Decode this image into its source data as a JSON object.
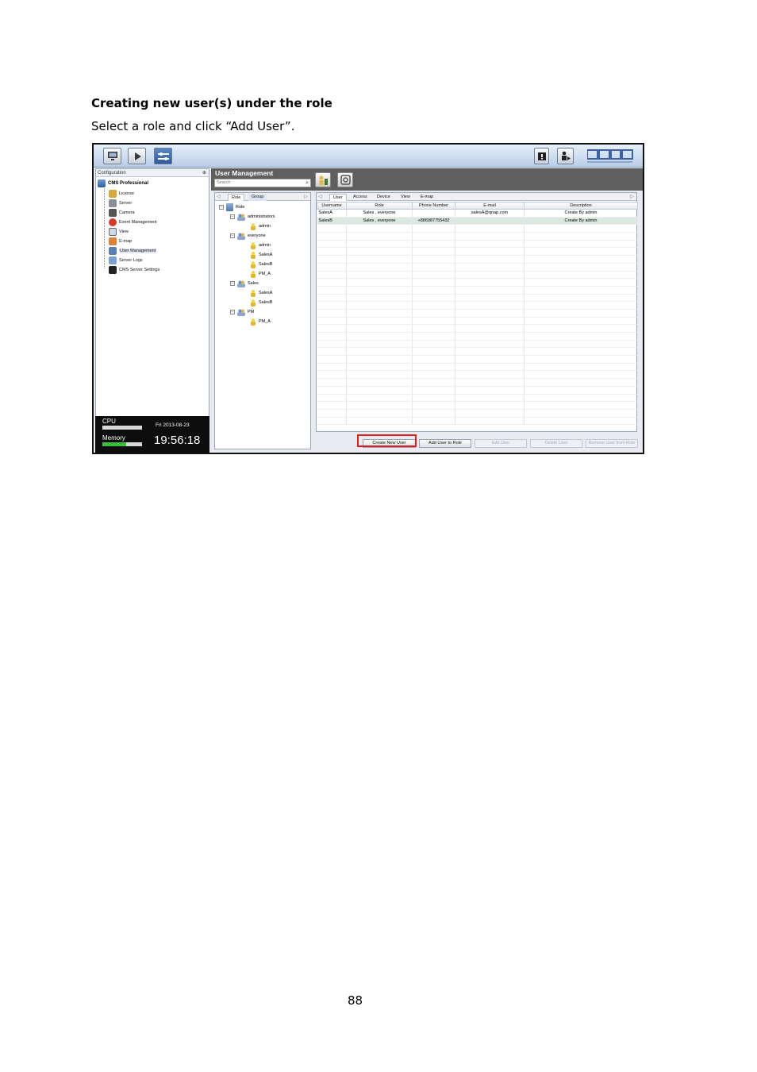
{
  "document": {
    "heading": "Creating new user(s) under the role",
    "instruction": "Select a role and click “Add User”.",
    "page_number": "88"
  },
  "app": {
    "toolbar": {
      "buttons": [
        "monitor-icon",
        "play-icon",
        "settings-icon"
      ],
      "right_icons": [
        "info-icon",
        "user-logout-icon"
      ],
      "logo_text": "QNAP",
      "logo_subtext": "SECURITY"
    },
    "left_panel": {
      "header": "Configuration",
      "pin": "⊕",
      "root": "CMS Professional",
      "items": [
        {
          "label": "License",
          "icon": "license-icon"
        },
        {
          "label": "Server",
          "icon": "server-icon"
        },
        {
          "label": "Camera",
          "icon": "camera-icon"
        },
        {
          "label": "Event Management",
          "icon": "event-icon"
        },
        {
          "label": "View",
          "icon": "view-icon"
        },
        {
          "label": "E-map",
          "icon": "emap-icon"
        },
        {
          "label": "User Management",
          "icon": "user-management-icon"
        },
        {
          "label": "Server Logs",
          "icon": "logs-icon"
        },
        {
          "label": "CMS Server Settings",
          "icon": "server-settings-icon"
        }
      ]
    },
    "status": {
      "cpu_label": "CPU",
      "memory_label": "Memory",
      "date": "Fri 2013-08-23",
      "time": "19:56:18",
      "memory_level": 0.6
    },
    "user_management": {
      "title": "User Management",
      "search_placeholder": "Search",
      "role_tabs": [
        "Role",
        "Group"
      ],
      "tree": {
        "root": "Role",
        "groups": [
          {
            "name": "administrators",
            "users": [
              "admin"
            ]
          },
          {
            "name": "everyone",
            "users": [
              "admin",
              "SalesA",
              "SalesB",
              "PM_A"
            ]
          },
          {
            "name": "Sales",
            "users": [
              "SalesA",
              "SalesB"
            ]
          },
          {
            "name": "PM",
            "users": [
              "PM_A"
            ]
          }
        ]
      },
      "user_tabs": [
        "User",
        "Access",
        "Device",
        "View",
        "E-map"
      ],
      "columns": [
        "Username",
        "Role",
        "Phone Number",
        "E-mail",
        "Description"
      ],
      "rows": [
        [
          "SalesA",
          "Sales , everyone",
          "",
          "salesA@qnap.com",
          "Create By admin"
        ],
        [
          "SalesB",
          "Sales , everyone",
          "+886987755432",
          "",
          "Create By admin"
        ]
      ],
      "buttons": {
        "create": "Create New User",
        "add_to_role": "Add User to Role",
        "edit": "Edit User",
        "delete": "Delete User",
        "remove": "Remove User from Role"
      }
    }
  }
}
